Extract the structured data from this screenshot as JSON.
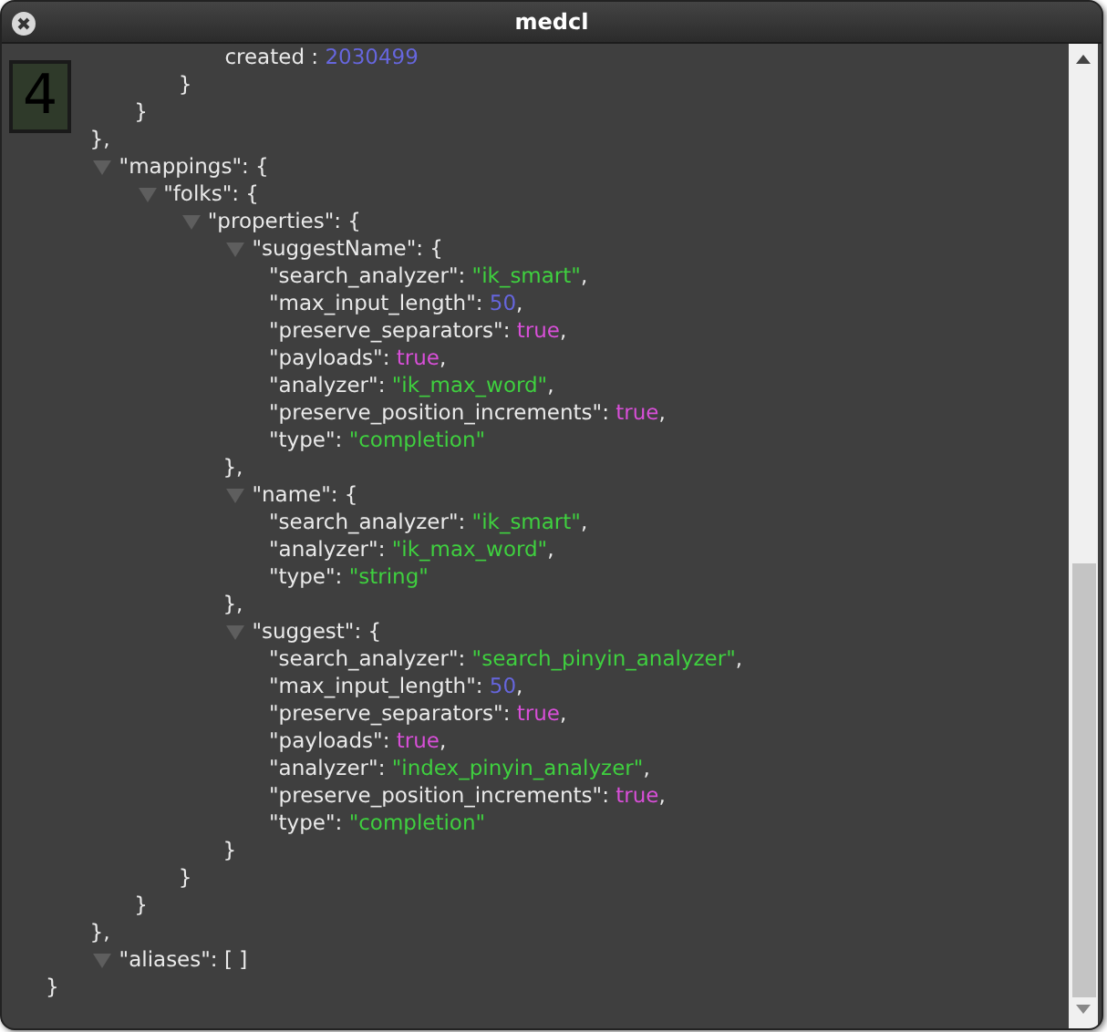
{
  "window": {
    "title": "medcl"
  },
  "badge": "4",
  "tree": {
    "kind": "tail",
    "close": "}",
    "children": [
      {
        "kind": "tail",
        "close": "},",
        "children": [
          {
            "kind": "tail",
            "close": "}",
            "children": [
              {
                "kind": "tail",
                "close": "}",
                "children": [
                  {
                    "kind": "number",
                    "key": "created",
                    "colon": " : ",
                    "value": "2030499"
                  }
                ]
              }
            ]
          }
        ]
      },
      {
        "kind": "object",
        "key": "\"mappings\"",
        "colon": ": ",
        "open": "{",
        "expanded": true,
        "close": "},",
        "children": [
          {
            "kind": "object",
            "key": "\"folks\"",
            "colon": ": ",
            "open": "{",
            "expanded": true,
            "close": "}",
            "children": [
              {
                "kind": "object",
                "key": "\"properties\"",
                "colon": ": ",
                "open": "{",
                "expanded": true,
                "close": "}",
                "children": [
                  {
                    "kind": "object",
                    "key": "\"suggestName\"",
                    "colon": ": ",
                    "open": "{",
                    "expanded": true,
                    "close": "},",
                    "children": [
                      {
                        "kind": "string",
                        "key": "\"search_analyzer\"",
                        "colon": ": ",
                        "value": "\"ik_smart\"",
                        "comma": ","
                      },
                      {
                        "kind": "number",
                        "key": "\"max_input_length\"",
                        "colon": ": ",
                        "value": "50",
                        "comma": ","
                      },
                      {
                        "kind": "boolean",
                        "key": "\"preserve_separators\"",
                        "colon": ": ",
                        "value": "true",
                        "comma": ","
                      },
                      {
                        "kind": "boolean",
                        "key": "\"payloads\"",
                        "colon": ": ",
                        "value": "true",
                        "comma": ","
                      },
                      {
                        "kind": "string",
                        "key": "\"analyzer\"",
                        "colon": ": ",
                        "value": "\"ik_max_word\"",
                        "comma": ","
                      },
                      {
                        "kind": "boolean",
                        "key": "\"preserve_position_increments\"",
                        "colon": ": ",
                        "value": "true",
                        "comma": ","
                      },
                      {
                        "kind": "string",
                        "key": "\"type\"",
                        "colon": ": ",
                        "value": "\"completion\""
                      }
                    ]
                  },
                  {
                    "kind": "object",
                    "key": "\"name\"",
                    "colon": ": ",
                    "open": "{",
                    "expanded": true,
                    "close": "},",
                    "children": [
                      {
                        "kind": "string",
                        "key": "\"search_analyzer\"",
                        "colon": ": ",
                        "value": "\"ik_smart\"",
                        "comma": ","
                      },
                      {
                        "kind": "string",
                        "key": "\"analyzer\"",
                        "colon": ": ",
                        "value": "\"ik_max_word\"",
                        "comma": ","
                      },
                      {
                        "kind": "string",
                        "key": "\"type\"",
                        "colon": ": ",
                        "value": "\"string\""
                      }
                    ]
                  },
                  {
                    "kind": "object",
                    "key": "\"suggest\"",
                    "colon": ": ",
                    "open": "{",
                    "expanded": true,
                    "close": "}",
                    "children": [
                      {
                        "kind": "string",
                        "key": "\"search_analyzer\"",
                        "colon": ": ",
                        "value": "\"search_pinyin_analyzer\"",
                        "comma": ","
                      },
                      {
                        "kind": "number",
                        "key": "\"max_input_length\"",
                        "colon": ": ",
                        "value": "50",
                        "comma": ","
                      },
                      {
                        "kind": "boolean",
                        "key": "\"preserve_separators\"",
                        "colon": ": ",
                        "value": "true",
                        "comma": ","
                      },
                      {
                        "kind": "boolean",
                        "key": "\"payloads\"",
                        "colon": ": ",
                        "value": "true",
                        "comma": ","
                      },
                      {
                        "kind": "string",
                        "key": "\"analyzer\"",
                        "colon": ": ",
                        "value": "\"index_pinyin_analyzer\"",
                        "comma": ","
                      },
                      {
                        "kind": "boolean",
                        "key": "\"preserve_position_increments\"",
                        "colon": ": ",
                        "value": "true",
                        "comma": ","
                      },
                      {
                        "kind": "string",
                        "key": "\"type\"",
                        "colon": ": ",
                        "value": "\"completion\""
                      }
                    ]
                  }
                ]
              }
            ]
          }
        ]
      },
      {
        "kind": "empty",
        "key": "\"aliases\"",
        "colon": ": ",
        "open": "[ ]",
        "expanded": true
      }
    ]
  }
}
